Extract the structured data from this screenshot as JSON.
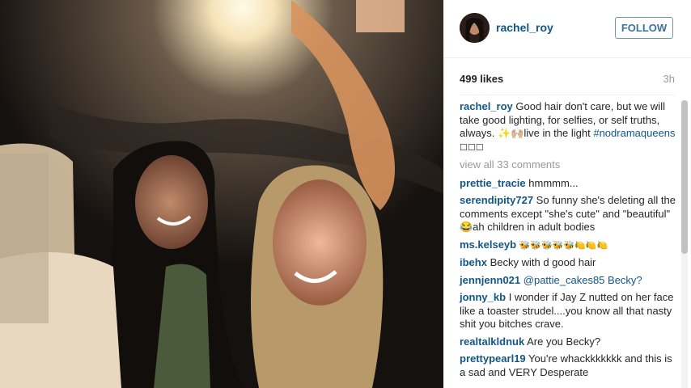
{
  "header": {
    "username": "rachel_roy",
    "follow_label": "FOLLOW"
  },
  "meta": {
    "likes": "499 likes",
    "age": "3h"
  },
  "caption": {
    "user": "rachel_roy",
    "text": "Good hair don't care, but we will take good lighting, for selfies, or self truths, always. ✨🙌🏼live in the light",
    "hashtag": "#nodramaqueens",
    "trailing": "☐☐☐"
  },
  "view_all": "view all 33 comments",
  "comments": [
    {
      "user": "prettie_tracie",
      "text": "hmmmm..."
    },
    {
      "user": "serendipity727",
      "text": "So funny she's deleting all the comments except \"she's cute\" and \"beautiful\" 😂ah children in adult bodies"
    },
    {
      "user": "ms.kelseyb",
      "text": "🐝🐝🐝🐝🐝🍋🍋🍋"
    },
    {
      "user": "ibehx",
      "text": "Becky with d good hair"
    },
    {
      "user": "jennjenn021",
      "text": "@pattie_cakes85 Becky?"
    },
    {
      "user": "jonny_kb",
      "text": "I wonder if Jay Z nutted on her face like a toaster strudel....you know all that nasty shit you bitches crave."
    },
    {
      "user": "realtalkldnuk",
      "text": "Are you Becky?"
    },
    {
      "user": "prettypearl19",
      "text": "You're whackkkkkkk and this is a sad and VERY Desperate"
    }
  ],
  "icons": {
    "avatar": "avatar-photo",
    "photo": "selfie-photo"
  }
}
